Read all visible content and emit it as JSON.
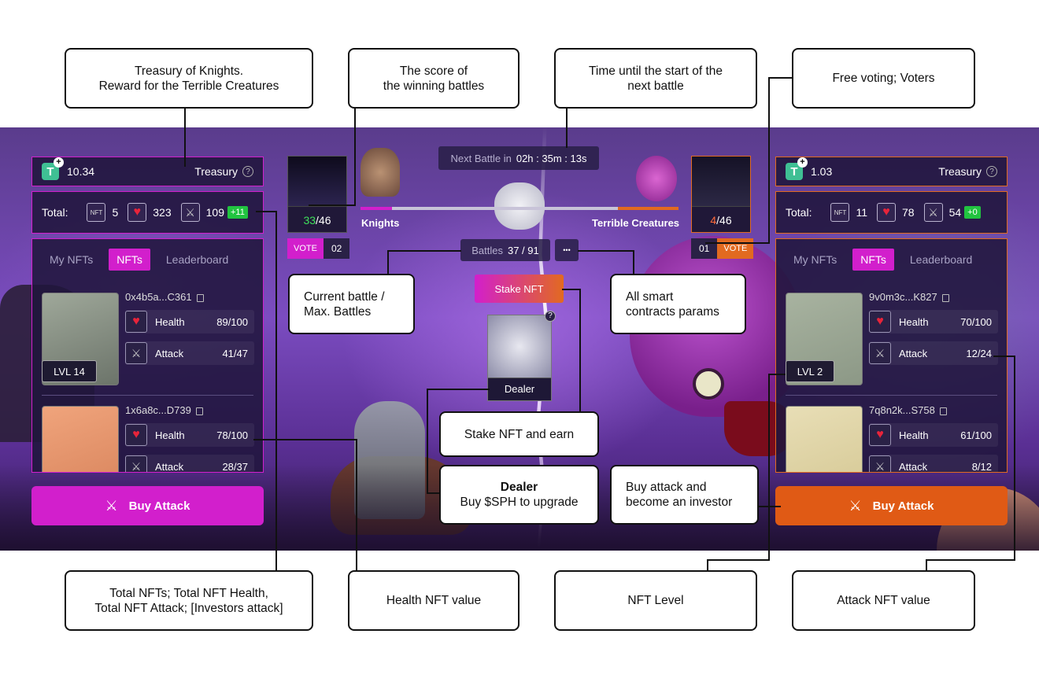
{
  "colors": {
    "accent_pink": "#d21fcc",
    "accent_orange": "#e26a20",
    "positive": "#21c440"
  },
  "icons": {
    "currency": "tether-icon",
    "nfts": "nft-box-icon",
    "health": "heart-icon",
    "attack": "swords-icon",
    "copy": "copy-icon",
    "info": "question-icon",
    "more": "ellipsis-icon"
  },
  "left": {
    "treasury_value": "10.34",
    "treasury_label": "Treasury",
    "total_label": "Total:",
    "nft_icon_text": "NFT",
    "total_nfts": "5",
    "total_health": "323",
    "total_attack": "109",
    "investors_attack": "+11",
    "tabs": [
      "My NFTs",
      "NFTs",
      "Leaderboard"
    ],
    "active_tab": "NFTs",
    "cards": [
      {
        "id": "0x4b5a...C361",
        "health_label": "Health",
        "health": "89/100",
        "attack_label": "Attack",
        "attack": "41/47",
        "level": "LVL  14"
      },
      {
        "id": "1x6a8c...D739",
        "health_label": "Health",
        "health": "78/100",
        "attack_label": "Attack",
        "attack": "28/37"
      }
    ],
    "buy_label": "Buy Attack"
  },
  "right": {
    "treasury_value": "1.03",
    "treasury_label": "Treasury",
    "total_label": "Total:",
    "nft_icon_text": "NFT",
    "total_nfts": "11",
    "total_health": "78",
    "total_attack": "54",
    "investors_attack": "+0",
    "tabs": [
      "My NFTs",
      "NFTs",
      "Leaderboard"
    ],
    "active_tab": "NFTs",
    "cards": [
      {
        "id": "9v0m3c...K827",
        "health_label": "Health",
        "health": "70/100",
        "attack_label": "Attack",
        "attack": "12/24",
        "level": "LVL  2"
      },
      {
        "id": "7q8n2k...S758",
        "health_label": "Health",
        "health": "61/100",
        "attack_label": "Attack",
        "attack": "8/12"
      }
    ],
    "buy_label": "Buy Attack"
  },
  "center": {
    "next_battle_label": "Next Battle in",
    "next_battle_time": "02h : 35m : 13s",
    "knights_score_won": "33",
    "knights_score_total": "/46",
    "creatures_score_won": "4",
    "creatures_score_total": "/46",
    "knights_label": "Knights",
    "creatures_label": "Terrible Creatures",
    "vote_label": "VOTE",
    "knights_voters": "02",
    "creatures_voters": "01",
    "battles_label": "Battles",
    "battles_value": "37 / 91",
    "more": "•••",
    "stake_label": "Stake NFT",
    "dealer_label": "Dealer",
    "dealer_help": "?"
  },
  "callouts": {
    "treasury": [
      "Treasury of Knights.",
      "Reward for the Terrible Creatures"
    ],
    "score": [
      "The score of",
      "the winning battles"
    ],
    "time": [
      "Time until the start of the",
      "next battle"
    ],
    "voting": [
      "Free voting; Voters"
    ],
    "battle": [
      "Current battle /",
      "Max. Battles"
    ],
    "params": [
      "All smart",
      "contracts params"
    ],
    "stake": [
      "Stake NFT and earn"
    ],
    "dealer_title": "Dealer",
    "dealer_text": "Buy $SPH to upgrade",
    "invest": [
      "Buy attack and",
      "become an investor"
    ],
    "totals": [
      "Total NFTs; Total NFT Health,",
      "Total NFT Attack; [Investors attack]"
    ],
    "health": [
      "Health NFT value"
    ],
    "level": [
      "NFT Level"
    ],
    "attack": [
      "Attack NFT value"
    ]
  }
}
